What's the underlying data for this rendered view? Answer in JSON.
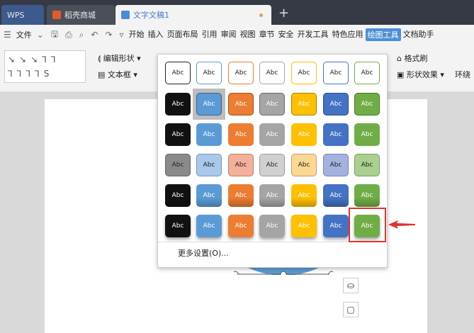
{
  "tabs": [
    {
      "label": "WPS"
    },
    {
      "label": "稻壳商城"
    },
    {
      "label": "文字文稿1"
    }
  ],
  "menu": {
    "file": "文件",
    "items": [
      "开始",
      "插入",
      "页面布局",
      "引用",
      "审阅",
      "视图",
      "章节",
      "安全",
      "开发工具",
      "特色应用",
      "绘图工具",
      "文档助手"
    ],
    "active": "绘图工具"
  },
  "ribbon": {
    "edit_shape": "编辑形状",
    "text_box": "文本框",
    "format_painter": "格式刷",
    "shape_effect": "形状效果",
    "wrap": "环绕"
  },
  "style_gallery": {
    "colors": [
      "#111111",
      "#5b9bd5",
      "#ed7d31",
      "#a5a5a5",
      "#ffc000",
      "#4472c4",
      "#70ad47"
    ],
    "light_colors": [
      "#8a8a8a",
      "#a9c8ec",
      "#f4b09a",
      "#d0d0d0",
      "#fbd891",
      "#a3b3e0",
      "#a9d08e"
    ],
    "rows": [
      [
        "Abc",
        "Abc",
        "Abc",
        "Abc",
        "Abc",
        "Abc",
        "Abc"
      ],
      [
        "Abc",
        "Abc",
        "Abc",
        "Abc",
        "Abc",
        "Abc",
        "Abc"
      ],
      [
        "Abc",
        "Abc",
        "Abc",
        "Abc",
        "Abc",
        "Abc",
        "Abc"
      ],
      [
        "Abc",
        "Abc",
        "Abc",
        "Abc",
        "Abc",
        "Abc",
        "Abc"
      ],
      [
        "Abc",
        "Abc",
        "Abc",
        "Abc",
        "Abc",
        "Abc",
        "Abc"
      ],
      [
        "Abc",
        "Abc",
        "Abc",
        "Abc",
        "Abc",
        "Abc",
        "Abc"
      ]
    ],
    "more_settings": "更多设置(O)..."
  }
}
